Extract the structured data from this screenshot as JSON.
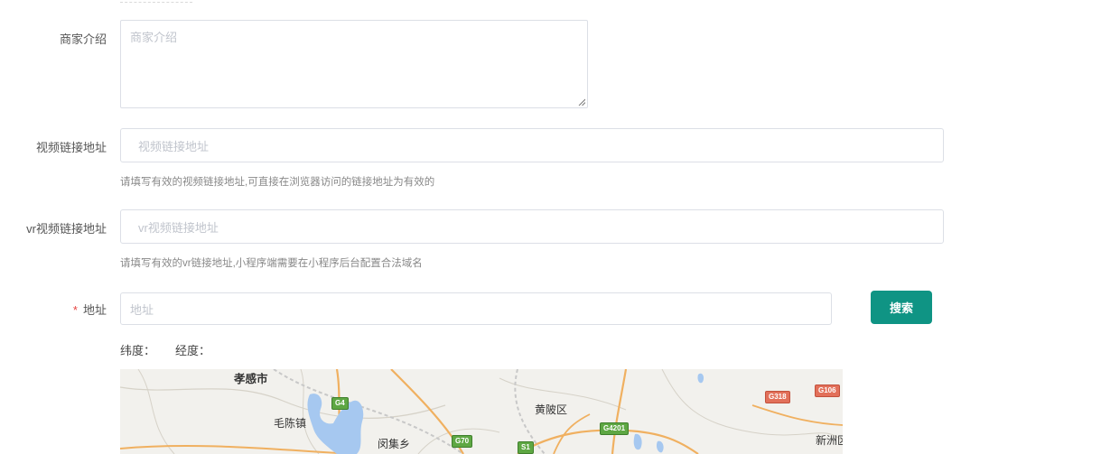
{
  "form": {
    "intro": {
      "label": "商家介绍",
      "placeholder": "商家介绍"
    },
    "video": {
      "label": "视频链接地址",
      "placeholder": "视频链接地址",
      "help": "请填写有效的视频链接地址,可直接在浏览器访问的链接地址为有效的"
    },
    "vr": {
      "label": "vr视频链接地址",
      "placeholder": "vr视频链接地址",
      "help": "请填写有效的vr链接地址,小程序端需要在小程序后台配置合法域名"
    },
    "address": {
      "required_mark": "*",
      "label": "地址",
      "placeholder": "地址",
      "search_label": "搜索"
    },
    "coords": {
      "lat_label": "纬度：",
      "lng_label": "经度："
    }
  },
  "map": {
    "places": [
      "孝感市",
      "毛陈镇",
      "闵集乡",
      "黄陂区",
      "新洲区"
    ],
    "shields": [
      {
        "text": "G4",
        "color": "#5ea743"
      },
      {
        "text": "G70",
        "color": "#5ea743"
      },
      {
        "text": "S1",
        "color": "#5ea743"
      },
      {
        "text": "G4201",
        "color": "#5ea743"
      },
      {
        "text": "G318",
        "color": "#e2705a"
      },
      {
        "text": "G106",
        "color": "#e2705a"
      }
    ]
  },
  "colors": {
    "primary": "#0f9484",
    "required": "#e64340",
    "border": "#dcdfe6"
  }
}
